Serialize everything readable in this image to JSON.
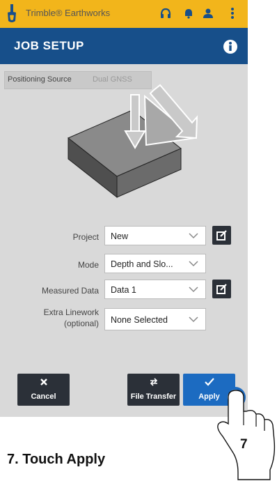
{
  "topbar": {
    "app_name": "Trimble® Earthworks",
    "background": "#f2b51b",
    "icons": [
      "trimble-logo-icon",
      "headset-icon",
      "bell-icon",
      "user-icon",
      "kebab-menu-icon"
    ]
  },
  "header": {
    "title": "JOB SETUP",
    "background": "#174f8a",
    "icon": "info-icon"
  },
  "positioning": {
    "label": "Positioning Source",
    "value": "Dual GNSS"
  },
  "form": {
    "project": {
      "label": "Project",
      "value": "New"
    },
    "mode": {
      "label": "Mode",
      "value": "Depth and Slo..."
    },
    "measured": {
      "label": "Measured Data",
      "value": "Data 1"
    },
    "extra": {
      "label_line1": "Extra Linework",
      "label_line2": "(optional)",
      "value": "None Selected"
    }
  },
  "buttons": {
    "cancel": "Cancel",
    "file_transfer": "File Transfer",
    "apply": "Apply"
  },
  "colors": {
    "dark_button": "#2b3038",
    "apply_button": "#1c6bc1"
  },
  "caption": "7. Touch Apply",
  "step_number": "7"
}
